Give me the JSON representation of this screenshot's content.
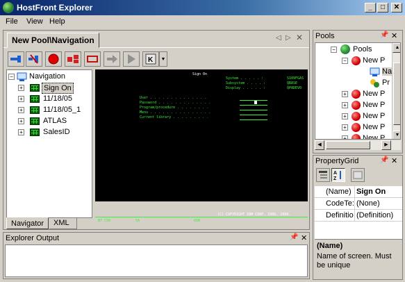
{
  "window": {
    "title": "HostFront Explorer"
  },
  "menu": [
    "File",
    "View",
    "Help"
  ],
  "document": {
    "tab_label": "New Pool\\Navigation",
    "tree": {
      "root": "Navigation",
      "items": [
        "Sign On",
        "11/18/05",
        "11/18/05_1",
        "ATLAS",
        "SalesID"
      ]
    },
    "screen": {
      "title": "Sign On",
      "sys_labels": [
        "System . . . . . :",
        "Subsystem . . . . :",
        "Display . . . . . :"
      ],
      "sys_values": [
        "S109FGAS",
        "QBASE",
        "QPADEV0"
      ],
      "fields": [
        "User . . . . . . . . . . . . . .",
        "Password . . . . . . . . . . . . .",
        "Program/procedure . . . . . . . .",
        "Menu . . . . . . . . . . . . . . .",
        "Current library . . . . . . . . ."
      ],
      "copyright": "(C) COPYRIGHT IBM CORP. 1980, 2000.",
      "status_left": "B7 C56",
      "status_mid": "5A",
      "status_right": "OVR"
    },
    "bottom_tabs": [
      "Navigator",
      "XML"
    ]
  },
  "output": {
    "title": "Explorer Output"
  },
  "pools": {
    "title": "Pools",
    "root": "Pools",
    "items": [
      "New P",
      "Na",
      "Pr",
      "New P",
      "New P",
      "New P",
      "New P",
      "New P"
    ]
  },
  "property_grid": {
    "title": "PropertyGrid",
    "rows": [
      {
        "name": "(Name)",
        "value": "Sign On"
      },
      {
        "name": "CodeTe:",
        "value": "(None)"
      },
      {
        "name": "Definitio",
        "value": "(Definition)"
      }
    ],
    "desc_title": "(Name)",
    "desc_text": "Name of screen. Must be unique"
  }
}
